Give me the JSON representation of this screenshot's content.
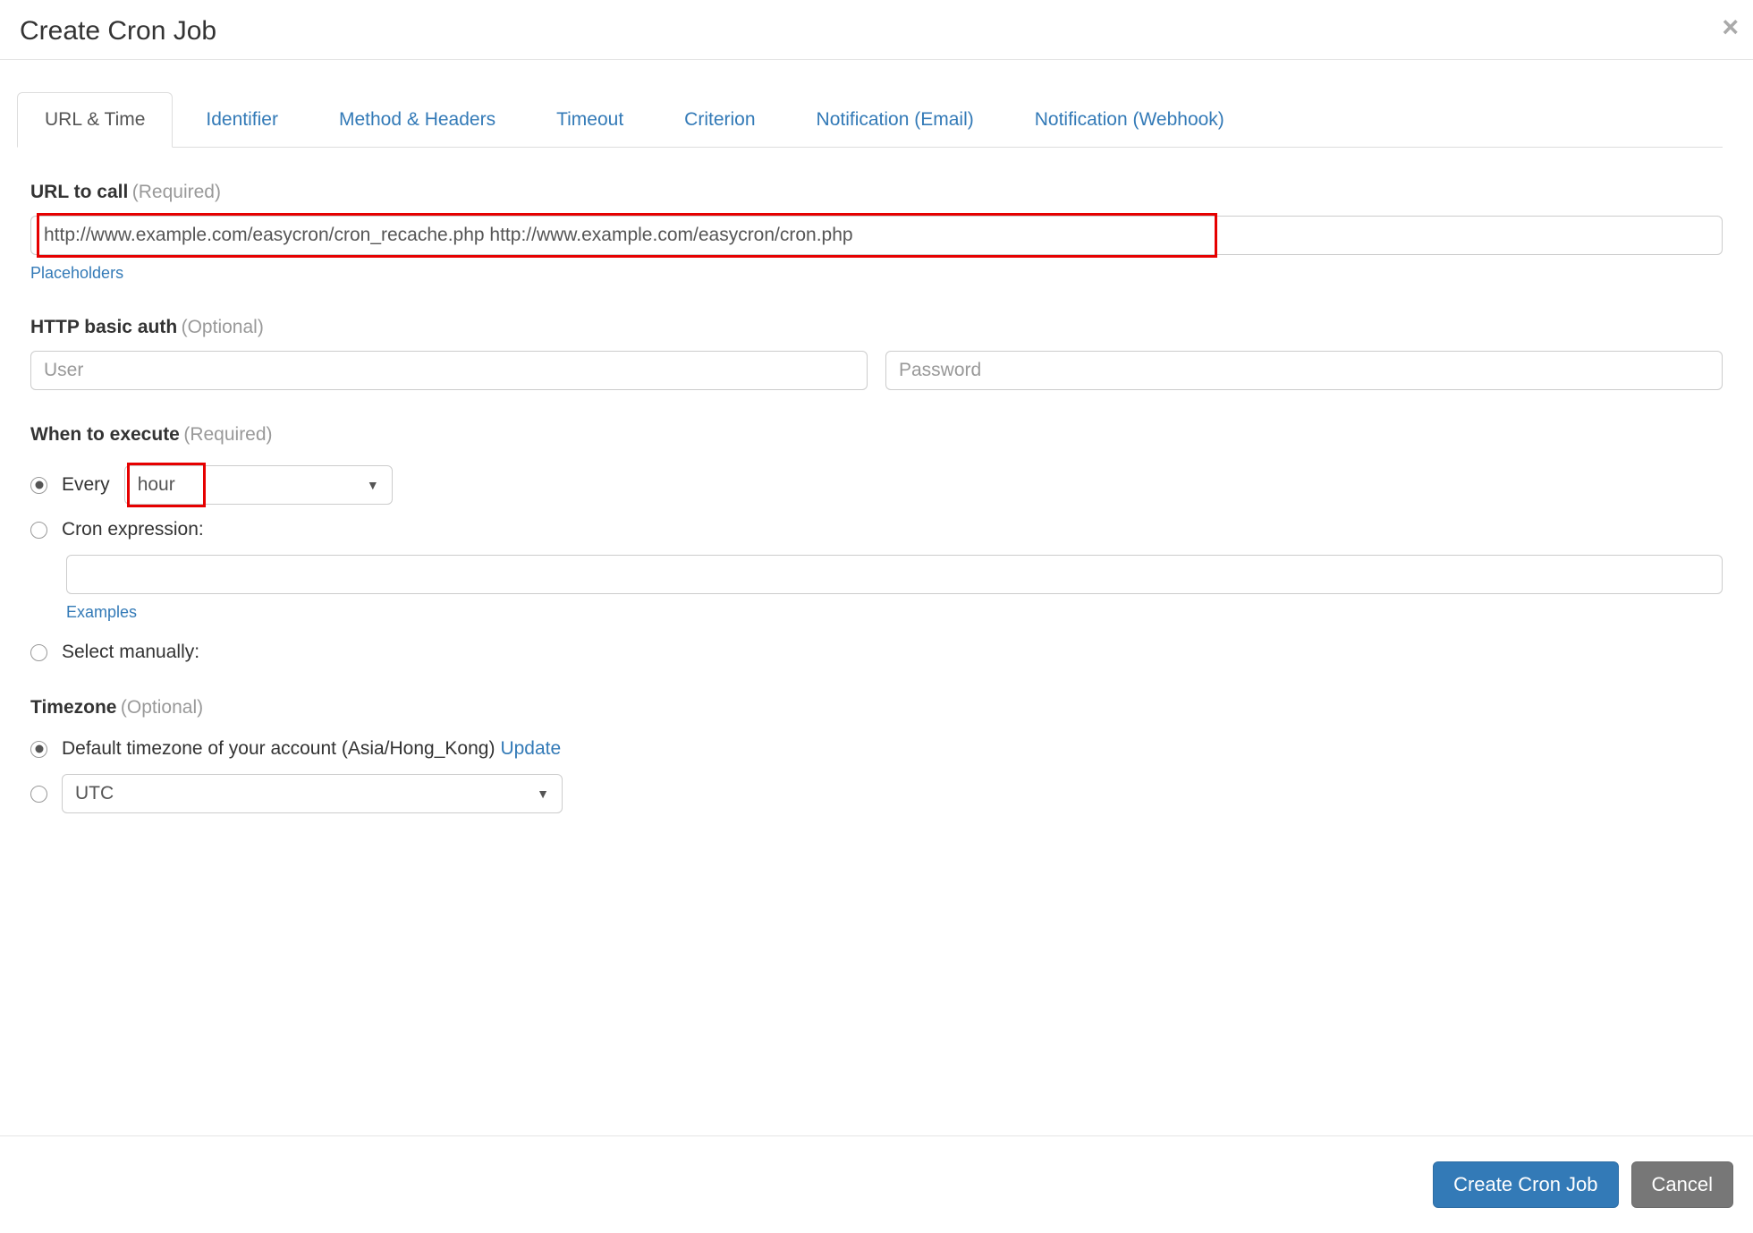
{
  "header": {
    "title": "Create Cron Job"
  },
  "tabs": [
    {
      "label": "URL & Time",
      "active": true
    },
    {
      "label": "Identifier",
      "active": false
    },
    {
      "label": "Method & Headers",
      "active": false
    },
    {
      "label": "Timeout",
      "active": false
    },
    {
      "label": "Criterion",
      "active": false
    },
    {
      "label": "Notification (Email)",
      "active": false
    },
    {
      "label": "Notification (Webhook)",
      "active": false
    }
  ],
  "form": {
    "url": {
      "label": "URL to call",
      "hint": "(Required)",
      "value": "http://www.example.com/easycron/cron_recache.php http://www.example.com/easycron/cron.php",
      "placeholders_link": "Placeholders"
    },
    "auth": {
      "label": "HTTP basic auth",
      "hint": "(Optional)",
      "user_placeholder": "User",
      "password_placeholder": "Password"
    },
    "schedule": {
      "label": "When to execute",
      "hint": "(Required)",
      "every_label": "Every",
      "every_value": "hour",
      "cron_label": "Cron expression:",
      "cron_value": "",
      "examples_link": "Examples",
      "manual_label": "Select manually:"
    },
    "timezone": {
      "label": "Timezone",
      "hint": "(Optional)",
      "default_label": "Default timezone of your account (Asia/Hong_Kong)",
      "update_link": "Update",
      "tz_value": "UTC"
    }
  },
  "footer": {
    "primary": "Create Cron Job",
    "cancel": "Cancel"
  }
}
